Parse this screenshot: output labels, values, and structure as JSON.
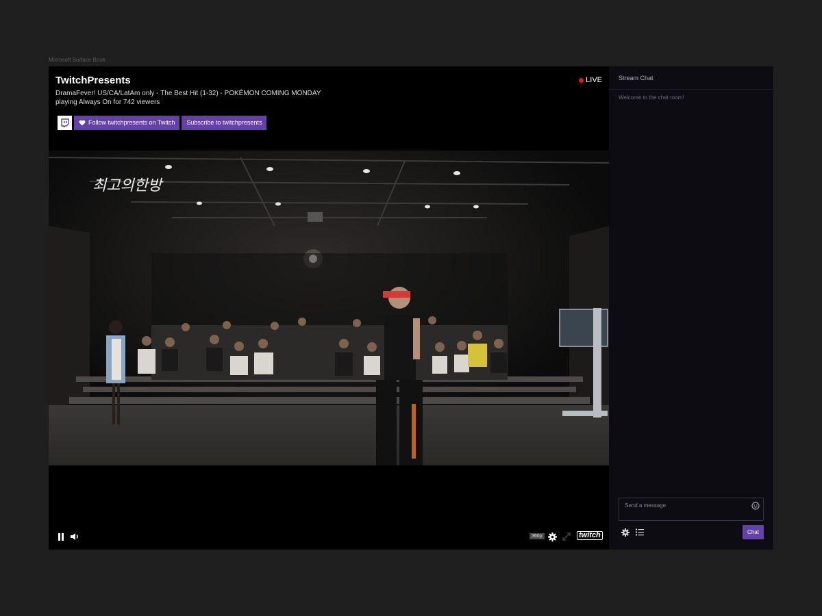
{
  "device_label": "Microsoft Surface Book",
  "channel": {
    "name": "TwitchPresents",
    "title": "DramaFever! US/CA/LatAm only - The Best Hit (1-32) - POKÉMON COMING MONDAY",
    "status_line": "playing Always On for 742 viewers"
  },
  "actions": {
    "follow_label": "Follow twitchpresents on Twitch",
    "subscribe_label": "Subscribe to twitchpresents"
  },
  "live_label": "LIVE",
  "video": {
    "overlay_logo_text": "최고의한방"
  },
  "controls": {
    "quality": "360p",
    "brand": "twitch"
  },
  "chat": {
    "header": "Stream Chat",
    "welcome": "Welcome to the chat room!",
    "input_placeholder": "Send a message",
    "send_label": "Chat"
  },
  "colors": {
    "accent": "#6441a4",
    "live_red": "#e91916",
    "chat_bg": "#0e0c13"
  },
  "icons": [
    "twitch-logo-icon",
    "heart-icon",
    "pause-icon",
    "volume-icon",
    "gear-icon",
    "fullscreen-icon",
    "emoji-icon",
    "list-icon"
  ]
}
